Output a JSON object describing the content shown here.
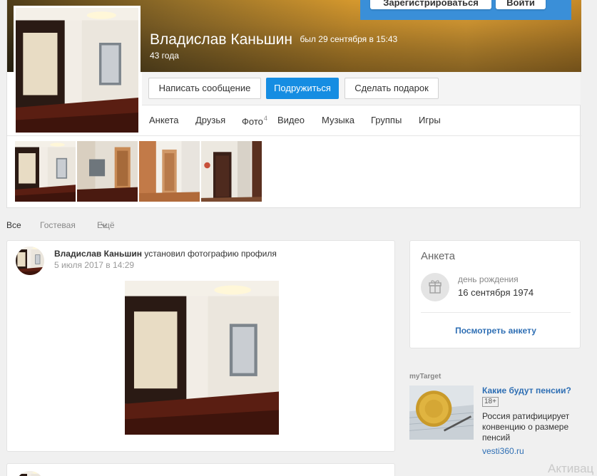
{
  "auth": {
    "register_label": "Зарегистрироваться",
    "login_label": "Войти"
  },
  "profile": {
    "name": "Владислав Каньшин",
    "last_seen": "был 29 сентября в 15:43",
    "age": "43 года"
  },
  "actions": {
    "message": "Написать сообщение",
    "add_friend": "Подружиться",
    "gift": "Сделать подарок"
  },
  "tabs": [
    {
      "label": "Анкета"
    },
    {
      "label": "Друзья"
    },
    {
      "label": "Фото",
      "count": "4"
    },
    {
      "label": "Видео"
    },
    {
      "label": "Музыка"
    },
    {
      "label": "Группы"
    },
    {
      "label": "Игры"
    }
  ],
  "feed_filter": {
    "all": "Все",
    "guestbook": "Гостевая",
    "more": "Ещё"
  },
  "post": {
    "author": "Владислав Каньшин",
    "action": "установил фотографию профиля",
    "date": "5 июля 2017 в 14:29"
  },
  "anketa": {
    "title": "Анкета",
    "birthday_label": "день рождения",
    "birthday_value": "16 сентября 1974",
    "view_link": "Посмотреть анкету"
  },
  "ad": {
    "source": "myTarget",
    "title": "Какие будут пенсии?",
    "age_badge": "18+",
    "text": "Россия ратифицирует конвенцию о размере пенсий",
    "domain": "vesti360.ru"
  },
  "watermark": "Активац",
  "colors": {
    "accent": "#168de2",
    "link": "#2f6fb4",
    "auth_panel": "#3a8fd8"
  }
}
